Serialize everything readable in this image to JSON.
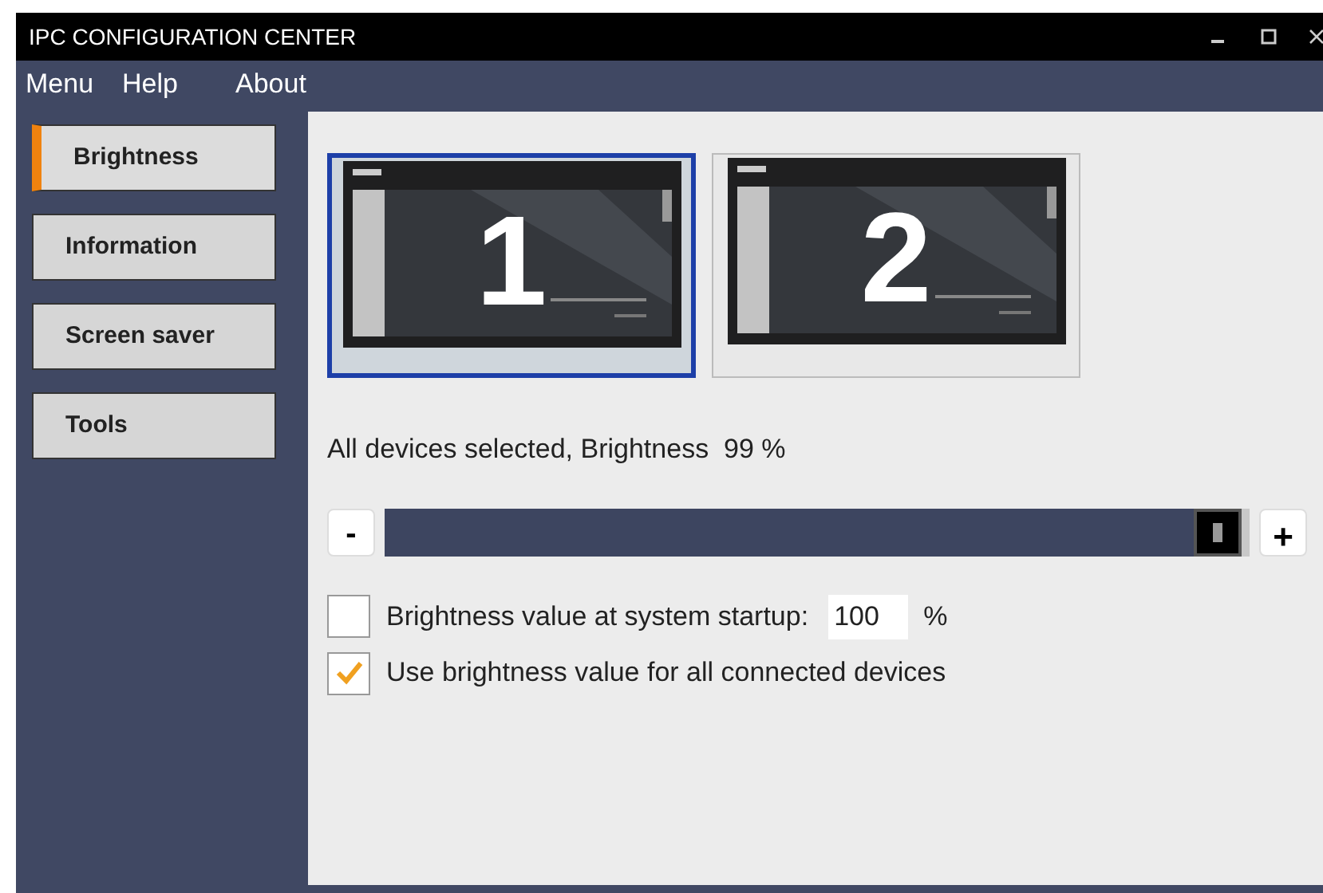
{
  "window": {
    "title": "IPC CONFIGURATION CENTER"
  },
  "menu": [
    "Menu",
    "Help",
    "About"
  ],
  "sidebar": {
    "items": [
      {
        "label": "Brightness",
        "selected": true
      },
      {
        "label": "Information",
        "selected": false
      },
      {
        "label": "Screen saver",
        "selected": false
      },
      {
        "label": "Tools",
        "selected": false
      }
    ]
  },
  "monitors": [
    {
      "label": "1",
      "selected": true
    },
    {
      "label": "2",
      "selected": false
    }
  ],
  "status": "All devices selected, Brightness  99 %",
  "slider": {
    "minus": "-",
    "plus": "+",
    "level": 0.99
  },
  "options": [
    {
      "kind": "startup",
      "label": "Brightness value at system startup:",
      "value": "100",
      "unit": "%",
      "checked": false
    },
    {
      "kind": "plain",
      "label": "Use brightness value for all connected devices",
      "checked": true
    }
  ]
}
